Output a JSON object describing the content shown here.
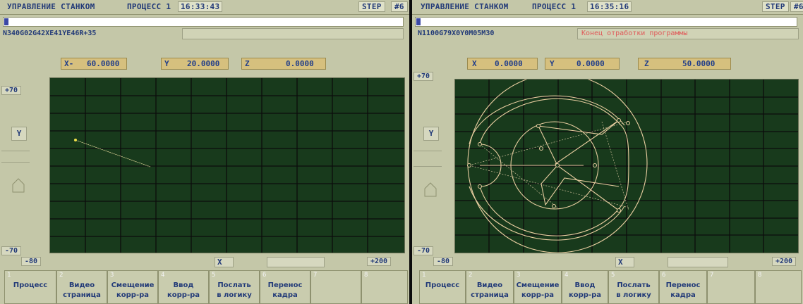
{
  "screens": [
    {
      "title": "УПРАВЛЕНИЕ СТАНКОМ",
      "process": "ПРОЦЕСС 1",
      "time": "16:33:43",
      "step_label": "STEP",
      "step_no": "#6",
      "program_line": "N340G02G42XE41YE46R+35",
      "message": "",
      "coords": {
        "x_label": "X-",
        "x_value": "60.0000",
        "y_label": "Y",
        "y_value": "20.0000",
        "z_label": "Z",
        "z_value": "0.0000"
      },
      "y_max": "+70",
      "y_min": "-70",
      "y_axis_name": "Y",
      "x_min": "-80",
      "x_axis_name": "X",
      "x_max": "+200"
    },
    {
      "title": "УПРАВЛЕНИЕ СТАНКОМ",
      "process": "ПРОЦЕСС 1",
      "time": "16:35:16",
      "step_label": "STEP",
      "step_no": "#6",
      "program_line": "N1100G79X0Y0M05M30",
      "message": "Конец отработки программы",
      "coords": {
        "x_label": "X",
        "x_value": "0.0000",
        "y_label": "Y",
        "y_value": "0.0000",
        "z_label": "Z",
        "z_value": "50.0000"
      },
      "y_max": "+70",
      "y_min": "-70",
      "y_axis_name": "Y",
      "x_min": "-80",
      "x_axis_name": "X",
      "x_max": "+200"
    }
  ],
  "softkeys": [
    {
      "num": "1",
      "label": "Процесс"
    },
    {
      "num": "2",
      "label": "Видео\nстраница"
    },
    {
      "num": "3",
      "label": "Смещение\nкорр-ра"
    },
    {
      "num": "4",
      "label": "Ввод\nкорр-ра"
    },
    {
      "num": "5",
      "label": "Послать\nв логику"
    },
    {
      "num": "6",
      "label": "Перенос\nкадра"
    },
    {
      "num": "7",
      "label": ""
    },
    {
      "num": "8",
      "label": ""
    }
  ],
  "colors": {
    "panel": "#c4c7a8",
    "grid_bg": "#183a1c",
    "grid_line": "#0c0c0c",
    "trace": "#e8cda0",
    "message": "#e05a5a",
    "text": "#223a78"
  }
}
